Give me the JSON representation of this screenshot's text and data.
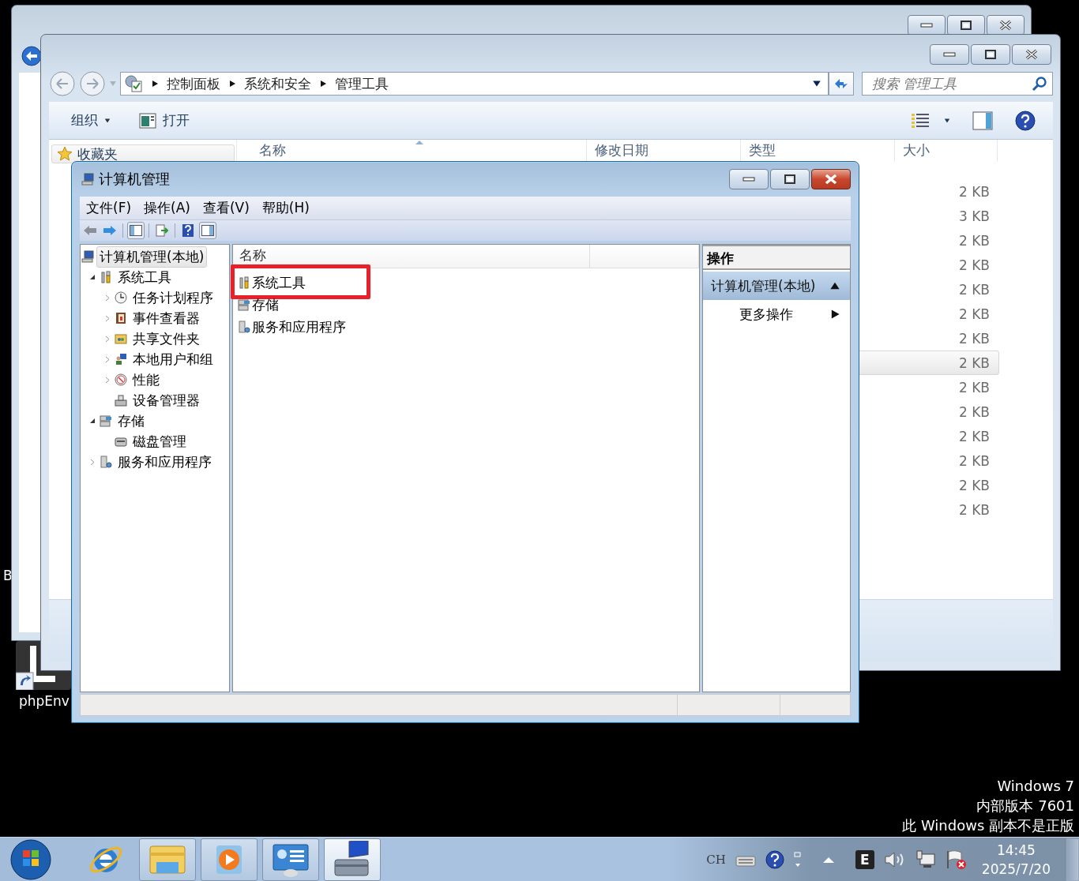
{
  "desktop": {
    "icons": [
      {
        "label": "B"
      },
      {
        "label": "phpEnv"
      }
    ],
    "version_text": [
      "Windows 7",
      "内部版本 7601",
      "此 Windows 副本不是正版"
    ]
  },
  "explorer": {
    "breadcrumb": [
      "控制面板",
      "系统和安全",
      "管理工具"
    ],
    "search": {
      "placeholder": "搜索 管理工具"
    },
    "toolbar": [
      {
        "label": "组织",
        "kind": "menu"
      },
      {
        "label": "打开",
        "kind": "action"
      }
    ],
    "nav_pane": {
      "items": [
        {
          "label": "收藏夹"
        }
      ]
    },
    "columns": [
      "名称",
      "修改日期",
      "类型",
      "大小"
    ],
    "rows": [
      {
        "size": "2 KB",
        "selected": false
      },
      {
        "size": "3 KB",
        "selected": false
      },
      {
        "size": "2 KB",
        "selected": false
      },
      {
        "size": "2 KB",
        "selected": false
      },
      {
        "size": "2 KB",
        "selected": false
      },
      {
        "size": "2 KB",
        "selected": false
      },
      {
        "size": "2 KB",
        "selected": false
      },
      {
        "size": "2 KB",
        "selected": true
      },
      {
        "size": "2 KB",
        "selected": false
      },
      {
        "size": "2 KB",
        "selected": false
      },
      {
        "size": "2 KB",
        "selected": false
      },
      {
        "size": "2 KB",
        "selected": false
      },
      {
        "size": "2 KB",
        "selected": false
      },
      {
        "size": "2 KB",
        "selected": false
      }
    ]
  },
  "computer_management": {
    "title": "计算机管理",
    "menu": [
      "文件(F)",
      "操作(A)",
      "查看(V)",
      "帮助(H)"
    ],
    "tree": [
      {
        "label": "计算机管理(本地)",
        "selected": true,
        "expandable": false,
        "children": [
          {
            "label": "系统工具",
            "selected": false,
            "expandable": true,
            "expanded": true,
            "children": [
              {
                "label": "任务计划程序",
                "selected": false,
                "expandable": true,
                "expanded": false
              },
              {
                "label": "事件查看器",
                "selected": false,
                "expandable": true,
                "expanded": false
              },
              {
                "label": "共享文件夹",
                "selected": false,
                "expandable": true,
                "expanded": false
              },
              {
                "label": "本地用户和组",
                "selected": false,
                "expandable": true,
                "expanded": false
              },
              {
                "label": "性能",
                "selected": false,
                "expandable": true,
                "expanded": false
              },
              {
                "label": "设备管理器",
                "selected": false,
                "expandable": false
              }
            ]
          },
          {
            "label": "存储",
            "selected": false,
            "expandable": true,
            "expanded": true,
            "children": [
              {
                "label": "磁盘管理",
                "selected": false,
                "expandable": false
              }
            ]
          },
          {
            "label": "服务和应用程序",
            "selected": false,
            "expandable": true,
            "expanded": false
          }
        ]
      }
    ],
    "list": {
      "columns": [
        "名称"
      ],
      "items": [
        {
          "label": "系统工具",
          "annotated": true
        },
        {
          "label": "存储",
          "annotated": false
        },
        {
          "label": "服务和应用程序",
          "annotated": false
        }
      ]
    },
    "actions": {
      "title": "操作",
      "group": {
        "label": "计算机管理(本地)",
        "expanded": true
      },
      "items": [
        {
          "label": "更多操作"
        }
      ]
    }
  },
  "taskbar": {
    "apps": [
      {
        "running": false,
        "selected": false
      },
      {
        "running": true,
        "selected": false
      },
      {
        "running": true,
        "selected": false
      },
      {
        "running": true,
        "selected": false
      },
      {
        "running": true,
        "selected": true
      }
    ],
    "tray": {
      "language": "CH",
      "badge": "E",
      "time": "14:45",
      "date": "2025/7/20"
    }
  }
}
